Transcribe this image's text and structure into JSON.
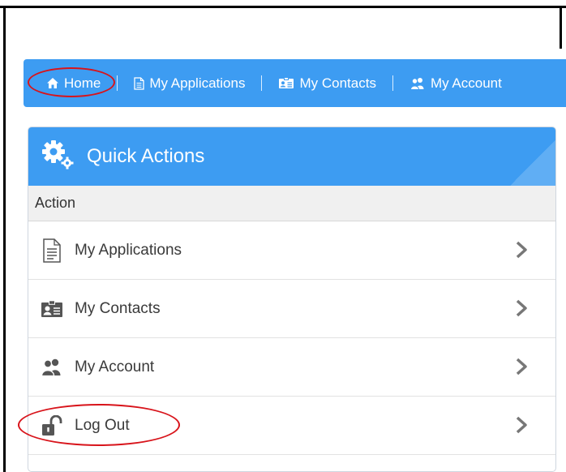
{
  "navbar": {
    "items": [
      {
        "label": "Home",
        "icon": "home-icon"
      },
      {
        "label": "My Applications",
        "icon": "document-icon"
      },
      {
        "label": "My Contacts",
        "icon": "contact-card-icon"
      },
      {
        "label": "My Account",
        "icon": "users-icon"
      }
    ]
  },
  "panel": {
    "title": "Quick Actions",
    "title_icon": "gears-icon",
    "column_header": "Action",
    "rows": [
      {
        "label": "My Applications",
        "icon": "document-icon"
      },
      {
        "label": "My Contacts",
        "icon": "contact-card-icon"
      },
      {
        "label": "My Account",
        "icon": "users-icon"
      },
      {
        "label": "Log Out",
        "icon": "unlock-icon"
      }
    ]
  },
  "colors": {
    "accent": "#3d9cf2",
    "highlight": "#d8141b"
  }
}
